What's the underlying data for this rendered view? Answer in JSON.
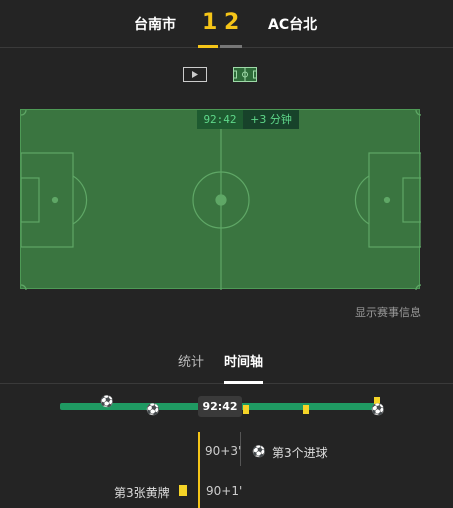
{
  "header": {
    "home_team": "台南市",
    "away_team": "AC台北",
    "home_score": "1",
    "away_score": "2"
  },
  "views": {
    "video_icon": "play-icon",
    "field_icon": "pitch-icon"
  },
  "pitch": {
    "clock": "92:42",
    "added_time": "+3 分钟",
    "colors": {
      "grass": "#3a7540",
      "lines": "#5fa766",
      "accent": "#5fd88a"
    }
  },
  "show_info_link": "显示赛事信息",
  "tabs": {
    "stats": "统计",
    "timeline": "时间轴"
  },
  "timeline": {
    "current_time": "92:42",
    "accent_color": "#1f9a62",
    "events": [
      {
        "time": "90+3'",
        "label": "第3个进球",
        "type": "goal"
      },
      {
        "time": "90+1'",
        "label": "第3张黄牌",
        "type": "yellow-card"
      }
    ]
  }
}
